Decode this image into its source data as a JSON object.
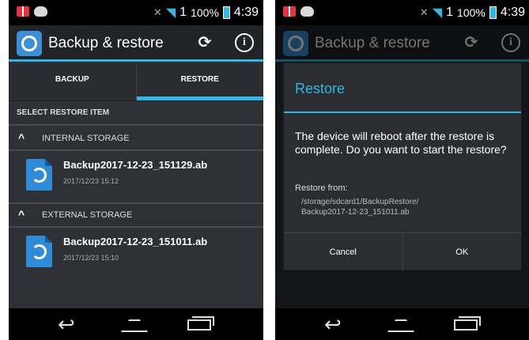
{
  "status_bar": {
    "signal": "1",
    "battery": "100%",
    "time": "4:39"
  },
  "app": {
    "title": "Backup & restore"
  },
  "tabs": [
    {
      "label": "BACKUP",
      "active": false
    },
    {
      "label": "RESTORE",
      "active": true
    }
  ],
  "restore": {
    "section_label": "SELECT RESTORE ITEM",
    "groups": [
      {
        "label": "INTERNAL STORAGE",
        "file": {
          "name": "Backup2017-12-23_151129.ab",
          "date": "2017/12/23 15:12"
        }
      },
      {
        "label": "EXTERNAL STORAGE",
        "file": {
          "name": "Backup2017-12-23_151011.ab",
          "date": "2017/12/23 15:10"
        }
      }
    ]
  },
  "dialog": {
    "title": "Restore",
    "message": "The device will reboot after the restore is complete. Do you want to start the restore?",
    "from_label": "Restore from:",
    "path_line1": "/storage/sdcard1/BackupRestore/",
    "path_line2": "Backup2017-12-23_151011.ab",
    "cancel_label": "Cancel",
    "ok_label": "OK"
  },
  "colors": {
    "accent": "#33b5e5",
    "background": "#2e3036",
    "file_icon": "#2f8bd6"
  },
  "icons": [
    "sync-icon",
    "info-icon",
    "back-icon",
    "home-icon",
    "recents-icon",
    "wifi-icon",
    "battery-icon"
  ]
}
